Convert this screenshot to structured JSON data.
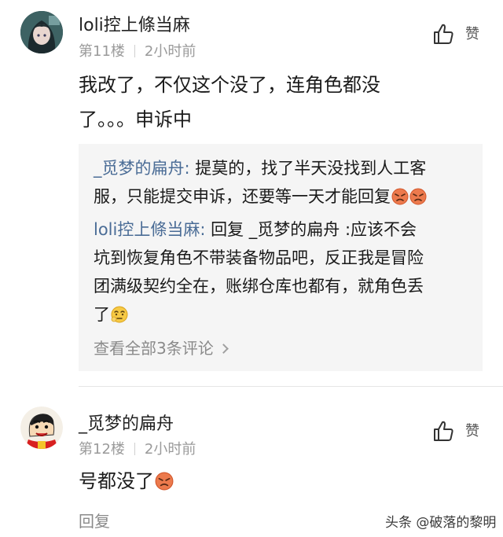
{
  "comments": [
    {
      "username": "loli控上條当麻",
      "floor": "第11楼",
      "time": "2小时前",
      "like_label": "赞",
      "lines": [
        "我改了，不仅这个没了，连角色都没",
        "了。。。申诉中"
      ],
      "avatar": "anime-girl-avatar"
    },
    {
      "username": "_觅梦的扁舟",
      "floor": "第12楼",
      "time": "2小时前",
      "like_label": "赞",
      "text": "号都没了",
      "avatar": "crayon-shinchan-avatar"
    }
  ],
  "replies": [
    {
      "name": "_觅梦的扁舟:",
      "line1": "提莫的，找了半天没找到人工客",
      "line2": "服，只能提交申诉，还要等一天才能回复"
    },
    {
      "name": "loli控上條当麻:",
      "line1_rest": "回复 _觅梦的扁舟 :应该不会",
      "line2": "坑到恢复角色不带装备物品吧，反正我是冒险",
      "line3": "团满级契约全在，账绑仓库也都有，就角色丢",
      "line4": "了"
    }
  ],
  "view_all": "查看全部3条评论",
  "reply_label": "回复",
  "watermark": "头条 @破落的黎明",
  "colors": {
    "name_link": "#4a6c96",
    "meta": "#9a9a9a",
    "reply_bg": "#f5f5f5"
  }
}
